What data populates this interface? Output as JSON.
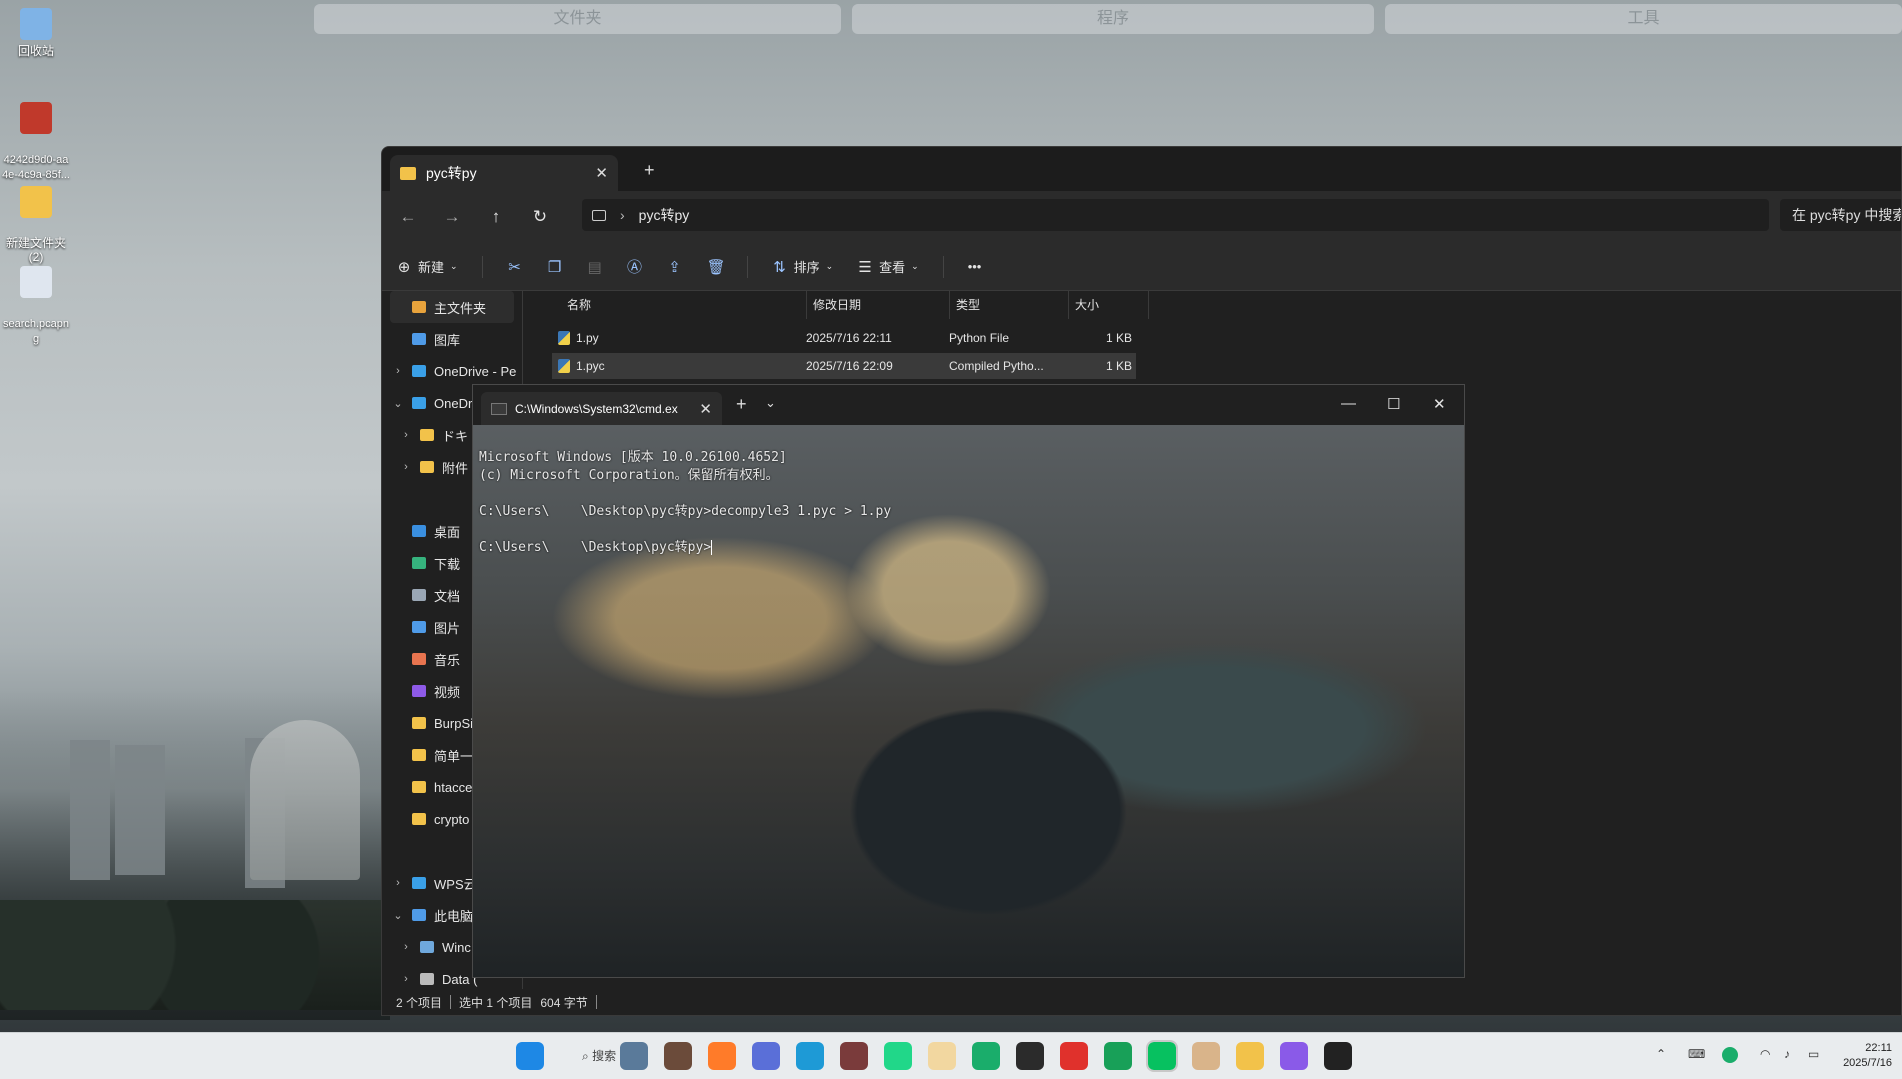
{
  "desktop": {
    "groups": [
      "文件夹",
      "程序",
      "工具"
    ],
    "icons": [
      {
        "label": "回收站",
        "color": "#7fb3e6"
      },
      {
        "label": "4242d9d0-aa\n4e-4c9a-85f...",
        "color": "#c0392b"
      },
      {
        "label": "新建文件夹\n(2)",
        "color": "#f2c24a"
      },
      {
        "label": "search.pcapn\ng",
        "color": "#dfe6ef"
      }
    ]
  },
  "explorer": {
    "tab_title": "pyc转py",
    "tab_close": "✕",
    "new_tab": "+",
    "nav": {
      "back": "←",
      "forward": "→",
      "up": "↑",
      "refresh": "↻"
    },
    "address": {
      "separator": "›",
      "path": "pyc转py"
    },
    "search_placeholder": "在 pyc转py 中搜索",
    "toolbar": {
      "new": "新建",
      "sort": "排序",
      "view": "查看",
      "more": "•••"
    },
    "nav_pane": [
      {
        "label": "主文件夹",
        "chev": "",
        "color": "#e8a33c",
        "selected": true
      },
      {
        "label": "图库",
        "chev": "",
        "color": "#4f9be8"
      },
      {
        "label": "OneDrive - Pe",
        "chev": "›",
        "color": "#3aa0e8"
      },
      {
        "label": "OneDr",
        "chev": "⌄",
        "color": "#3aa0e8"
      },
      {
        "label": "ドキ",
        "chev": "›",
        "color": "#f2c24a",
        "indent": true
      },
      {
        "label": "附件",
        "chev": "›",
        "color": "#f2c24a",
        "indent": true
      },
      {
        "label": "",
        "chev": "",
        "color": "transparent"
      },
      {
        "label": "桌面",
        "chev": "",
        "color": "#3a8fe0"
      },
      {
        "label": "下载",
        "chev": "",
        "color": "#36b37e"
      },
      {
        "label": "文档",
        "chev": "",
        "color": "#9aa7b5"
      },
      {
        "label": "图片",
        "chev": "",
        "color": "#4f9be8"
      },
      {
        "label": "音乐",
        "chev": "",
        "color": "#e8744f"
      },
      {
        "label": "视频",
        "chev": "",
        "color": "#8e5ae8"
      },
      {
        "label": "BurpSi",
        "chev": "",
        "color": "#f2c24a"
      },
      {
        "label": "简单一",
        "chev": "",
        "color": "#f2c24a"
      },
      {
        "label": "htacce",
        "chev": "",
        "color": "#f2c24a"
      },
      {
        "label": "crypto",
        "chev": "",
        "color": "#f2c24a"
      },
      {
        "label": "",
        "chev": "",
        "color": "transparent"
      },
      {
        "label": "WPS云",
        "chev": "›",
        "color": "#3aa0e8"
      },
      {
        "label": "此电脑",
        "chev": "⌄",
        "color": "#4f9be8"
      },
      {
        "label": "Winc",
        "chev": "›",
        "color": "#6fa8dc",
        "indent": true
      },
      {
        "label": "Data (",
        "chev": "›",
        "color": "#bbbbbb",
        "indent": true
      }
    ],
    "columns": {
      "name": "名称",
      "date": "修改日期",
      "type": "类型",
      "size": "大小"
    },
    "files": [
      {
        "name": "1.py",
        "date": "2025/7/16 22:11",
        "type": "Python File",
        "size": "1 KB",
        "selected": false
      },
      {
        "name": "1.pyc",
        "date": "2025/7/16 22:09",
        "type": "Compiled Pytho...",
        "size": "1 KB",
        "selected": true
      }
    ],
    "status": {
      "count": "2 个项目",
      "selection": "选中 1 个项目",
      "bytes": "604 字节"
    }
  },
  "cmd": {
    "tab_title": "C:\\Windows\\System32\\cmd.ex",
    "controls": {
      "minimize": "—",
      "maximize": "☐",
      "close": "✕",
      "plus": "+",
      "dropdown": "⌄"
    },
    "lines": [
      "Microsoft Windows [版本 10.0.26100.4652]",
      "(c) Microsoft Corporation。保留所有权利。",
      "",
      "C:\\Users\\    \\Desktop\\pyc转py>decompyle3 1.pyc > 1.py",
      "",
      "C:\\Users\\    \\Desktop\\pyc转py>"
    ]
  },
  "taskbar": {
    "search_label": "搜索",
    "apps": [
      {
        "name": "start",
        "color": "#1e88e5"
      },
      {
        "name": "app",
        "color": "#5a7a9a"
      },
      {
        "name": "app",
        "color": "#6b4b3a"
      },
      {
        "name": "firefox",
        "color": "#ff7b29"
      },
      {
        "name": "app",
        "color": "#5a6fd8"
      },
      {
        "name": "edge",
        "color": "#1e9ad6"
      },
      {
        "name": "app",
        "color": "#7a3b3b"
      },
      {
        "name": "pycharm",
        "color": "#21d789"
      },
      {
        "name": "app",
        "color": "#f2d7a0"
      },
      {
        "name": "app",
        "color": "#1aad6b"
      },
      {
        "name": "terminal",
        "color": "#2b2b2b"
      },
      {
        "name": "netease",
        "color": "#e0312c"
      },
      {
        "name": "app",
        "color": "#18a058"
      },
      {
        "name": "wechat",
        "color": "#07c160"
      },
      {
        "name": "app",
        "color": "#d9b48a"
      },
      {
        "name": "explorer",
        "color": "#f2c24a"
      },
      {
        "name": "app",
        "color": "#8a5ae8"
      },
      {
        "name": "app",
        "color": "#222222"
      }
    ],
    "clock_time": "22:11",
    "clock_date": "2025/7/16"
  }
}
